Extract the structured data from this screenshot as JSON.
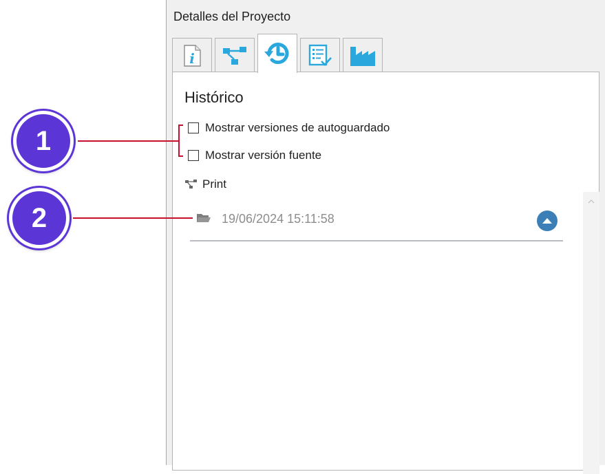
{
  "panel": {
    "title": "Detalles del Proyecto",
    "tabs": [
      {
        "icon": "info-icon",
        "active": false
      },
      {
        "icon": "flow-diagram-icon",
        "active": false
      },
      {
        "icon": "history-icon",
        "active": true
      },
      {
        "icon": "checklist-icon",
        "active": false
      },
      {
        "icon": "factory-icon",
        "active": false
      }
    ]
  },
  "history": {
    "title": "Histórico",
    "checkboxes": [
      {
        "label": "Mostrar versiones de autoguardado",
        "checked": false
      },
      {
        "label": "Mostrar versión fuente",
        "checked": false
      }
    ],
    "project": {
      "icon": "flow-diagram-icon",
      "name": "Print"
    },
    "versions": [
      {
        "icon": "folder-icon",
        "date": "19/06/2024 15:11:58"
      }
    ]
  },
  "callouts": [
    {
      "number": "1"
    },
    {
      "number": "2"
    }
  ],
  "colors": {
    "accent_blue": "#3b7fb6",
    "tab_icon_blue": "#2aa8de",
    "callout_purple": "#5c35d6",
    "callout_line_red": "#c8102e"
  }
}
